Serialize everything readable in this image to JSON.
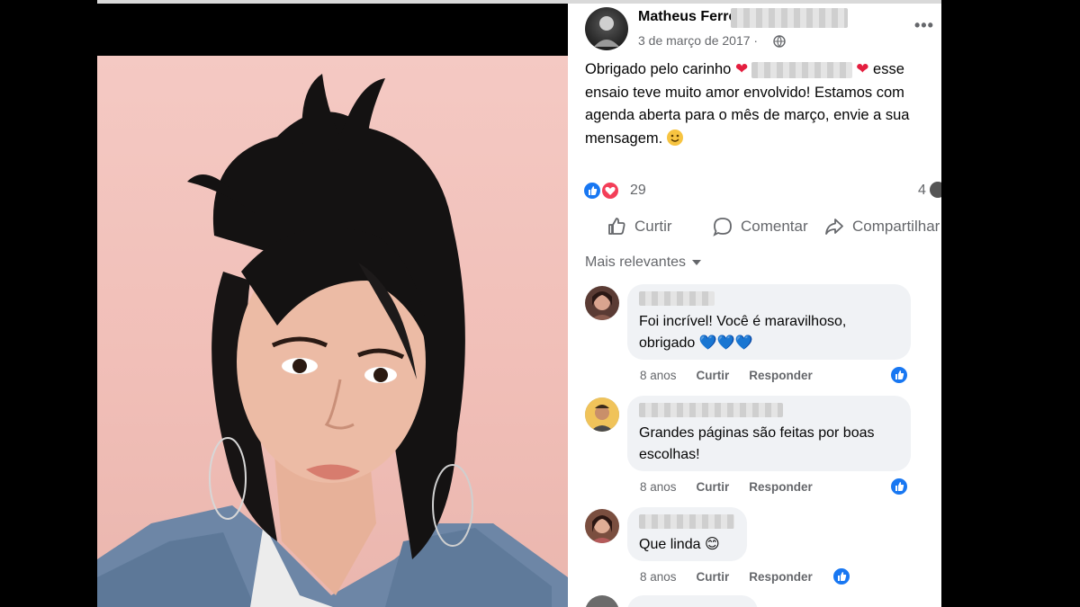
{
  "photo": {
    "alt": ""
  },
  "post": {
    "author": "Matheus Ferrero",
    "date": "3 de março de 2017 ·",
    "text_part1": "Obrigado pelo carinho",
    "text_part2": "esse ensaio teve muito amor envolvido! Estamos com agenda aberta para o mês de março, envie a sua mensagem.",
    "reaction_count": "29",
    "comment_count": "4",
    "actions": {
      "like": "Curtir",
      "comment": "Comentar",
      "share": "Compartilhar"
    },
    "sort_label": "Mais relevantes"
  },
  "comments": [
    {
      "text": "Foi incrível! Você é maravilhoso, obrigado 💙💙💙",
      "age": "8 anos",
      "like": "Curtir",
      "reply": "Responder"
    },
    {
      "text": "Grandes páginas são feitas por boas escolhas!",
      "age": "8 anos",
      "like": "Curtir",
      "reply": "Responder"
    },
    {
      "text": "Que linda 😊",
      "age": "8 anos",
      "like": "Curtir",
      "reply": "Responder"
    }
  ],
  "colors": {
    "accent": "#1877f2",
    "love": "#f33e58",
    "bubble": "#f0f2f5",
    "muted": "#65676b",
    "photo_bg": "#f4c9c3"
  },
  "icons": [
    "globe-icon",
    "more-icon",
    "like-icon",
    "love-icon",
    "comment-icon",
    "share-icon",
    "chevron-down-icon"
  ]
}
